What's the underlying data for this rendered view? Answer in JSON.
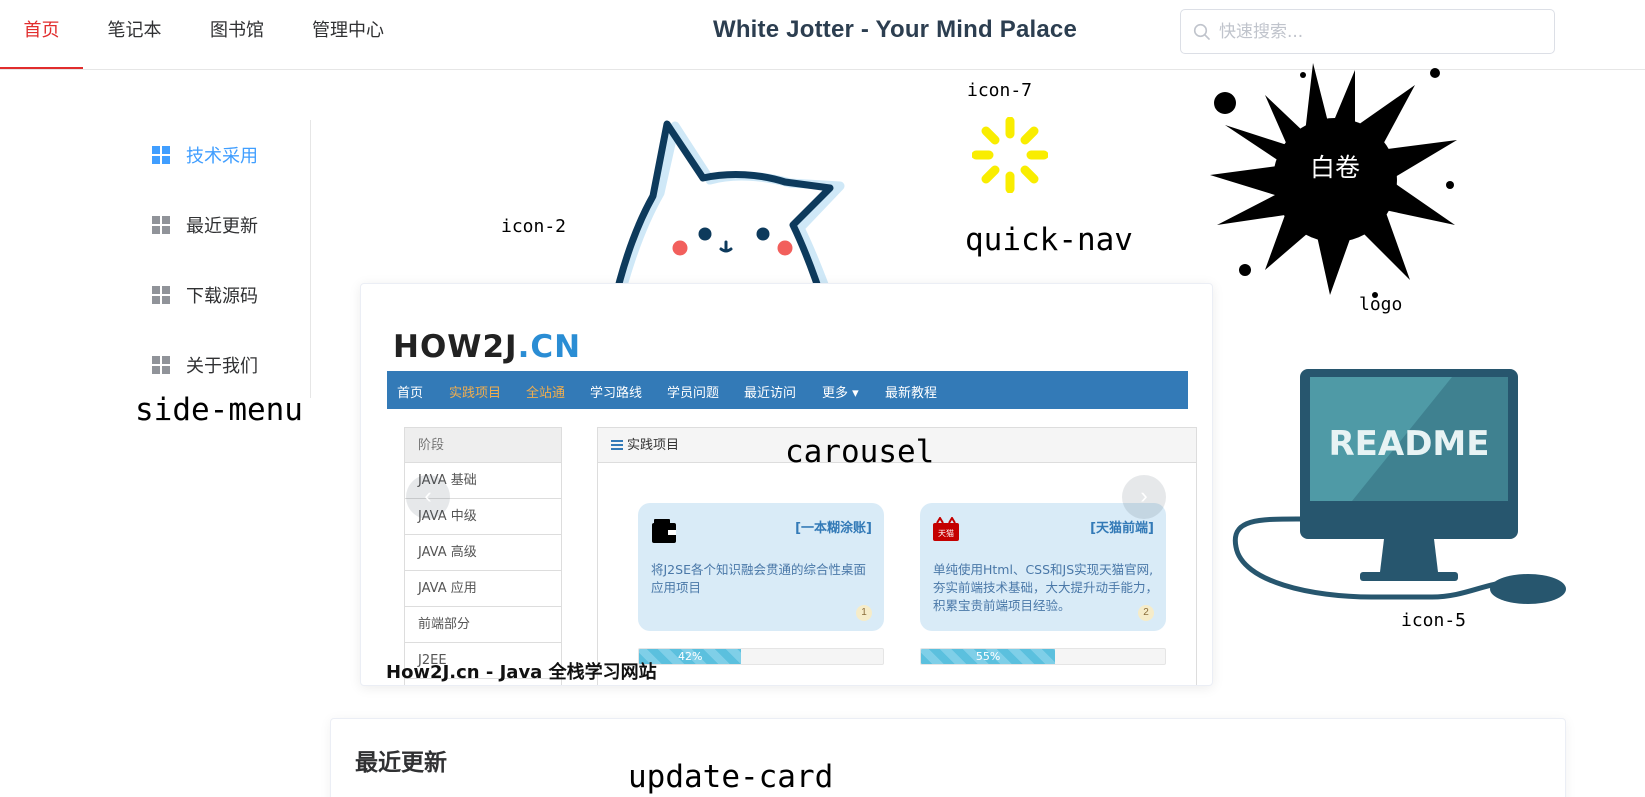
{
  "header": {
    "tabs": [
      {
        "label": "首页",
        "active": true
      },
      {
        "label": "笔记本",
        "active": false
      },
      {
        "label": "图书馆",
        "active": false
      },
      {
        "label": "管理中心",
        "active": false
      }
    ],
    "title": "White Jotter - Your Mind Palace",
    "search": {
      "placeholder": "快速搜索...",
      "value": ""
    },
    "accent_color": "#e12d2d"
  },
  "side_menu": {
    "items": [
      {
        "label": "技术采用",
        "active": true,
        "icon": "grid-icon"
      },
      {
        "label": "最近更新",
        "active": false,
        "icon": "grid-icon"
      },
      {
        "label": "下载源码",
        "active": false,
        "icon": "grid-icon"
      },
      {
        "label": "关于我们",
        "active": false,
        "icon": "grid-icon"
      }
    ],
    "active_color": "#409eff"
  },
  "annotations": {
    "side_menu": "side-menu",
    "icon_2": "icon-2",
    "icon_7": "icon-7",
    "quick_nav": "quick-nav",
    "logo": "logo",
    "carousel": "carousel",
    "icon_5": "icon-5",
    "update_card": "update-card"
  },
  "logo": {
    "text": "白卷"
  },
  "monitor": {
    "screen_text": "README"
  },
  "carousel": {
    "caption": "How2J.cn - Java 全栈学习网站",
    "slide": {
      "brand_left": "HOW2J",
      "brand_right": ".CN",
      "nav": [
        {
          "label": "首页",
          "highlight": false
        },
        {
          "label": "实践项目",
          "highlight": true
        },
        {
          "label": "全站通",
          "highlight": true
        },
        {
          "label": "学习路线",
          "highlight": false
        },
        {
          "label": "学员问题",
          "highlight": false
        },
        {
          "label": "最近访问",
          "highlight": false
        },
        {
          "label": "更多 ▾",
          "highlight": false
        },
        {
          "label": "最新教程",
          "highlight": false
        }
      ],
      "sidebar_header": "阶段",
      "sidebar_items": [
        "JAVA 基础",
        "JAVA 中级",
        "JAVA 高级",
        "JAVA 应用",
        "前端部分",
        "J2EE"
      ],
      "panel_header": "实践项目",
      "cards": [
        {
          "title": "[一本糊涂账]",
          "text": "将J2SE各个知识融会贯通的综合性桌面应用项目",
          "number": "1",
          "progress_label": "42%",
          "progress": 0.42,
          "icon": "wallet-icon"
        },
        {
          "title": "[天猫前端]",
          "text": "单纯使用Html、CSS和JS实现天猫官网, 夯实前端技术基础，大大提升动手能力，积累宝贵前端项目经验。",
          "number": "2",
          "progress_label": "55%",
          "progress": 0.55,
          "icon": "tmall-icon",
          "icon_text": "天猫"
        }
      ],
      "prev_arrow": "‹",
      "next_arrow": "›"
    }
  },
  "update_card": {
    "title": "最近更新"
  }
}
